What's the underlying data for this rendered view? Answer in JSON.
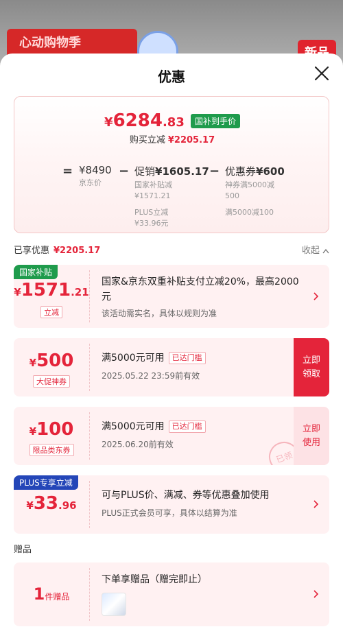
{
  "backdrop": {
    "banner_text": "心动购物季",
    "new_tag": "新品"
  },
  "sheet": {
    "title": "优惠"
  },
  "summary": {
    "final_price_yen": "¥",
    "final_price_int": "6284",
    "final_price_dec": ".83",
    "subsidy_badge": "国补到手价",
    "buy_label": "购买立减",
    "buy_amount": "¥2205.17",
    "formula": {
      "eq": "=",
      "minus1": "−",
      "minus2": "−",
      "jd_price": "¥8490",
      "jd_price_label": "京东价",
      "promo_label": "促销",
      "promo_amount": "¥1605.17",
      "promo_sub1": "国家补贴减",
      "promo_sub1_amt": "¥1571.21",
      "promo_sub2": "PLUS立减",
      "promo_sub2_amt": "¥33.96元",
      "coupon_label": "优惠券",
      "coupon_amount": "¥600",
      "coupon_sub1": "神券满5000减",
      "coupon_sub1_amt": "500",
      "coupon_sub2": "满5000减100"
    }
  },
  "enjoyed": {
    "label": "已享优惠",
    "amount": "¥2205.17",
    "collapse_label": "收起"
  },
  "cards": {
    "national": {
      "corner": "国家补贴",
      "yen": "¥",
      "amount_int": "1571",
      "amount_dec": ".21",
      "tag": "立减",
      "desc": "国家&京东双重补贴支付立减20%，最高2000元",
      "sub": "该活动需实名，具体以规则为准"
    },
    "coupon500": {
      "yen": "¥",
      "amount": "500",
      "tag": "大促神券",
      "desc": "满5000元可用",
      "reached": "已达门槛",
      "sub": "2025.05.22  23:59前有效",
      "action": "立即领取"
    },
    "coupon100": {
      "yen": "¥",
      "amount": "100",
      "tag": "限品类东券",
      "desc": "满5000元可用",
      "reached": "已达门槛",
      "sub": "2025.06.20前有效",
      "action": "立即使用",
      "stamp": "已领"
    },
    "plus": {
      "corner": "PLUS专享立减",
      "yen": "¥",
      "amount_int": "33",
      "amount_dec": ".96",
      "desc": "可与PLUS价、满减、券等优惠叠加使用",
      "sub": "PLUS正式会员可享，具体以结算为准"
    }
  },
  "gifts": {
    "label": "赠品",
    "count": "1",
    "count_unit": "件赠品",
    "desc": "下单享赠品（赠完即止）"
  },
  "colors": {
    "accent": "#e4243a",
    "subsidy_green": "#1f9b4c",
    "plus_blue": "#2446b8"
  }
}
